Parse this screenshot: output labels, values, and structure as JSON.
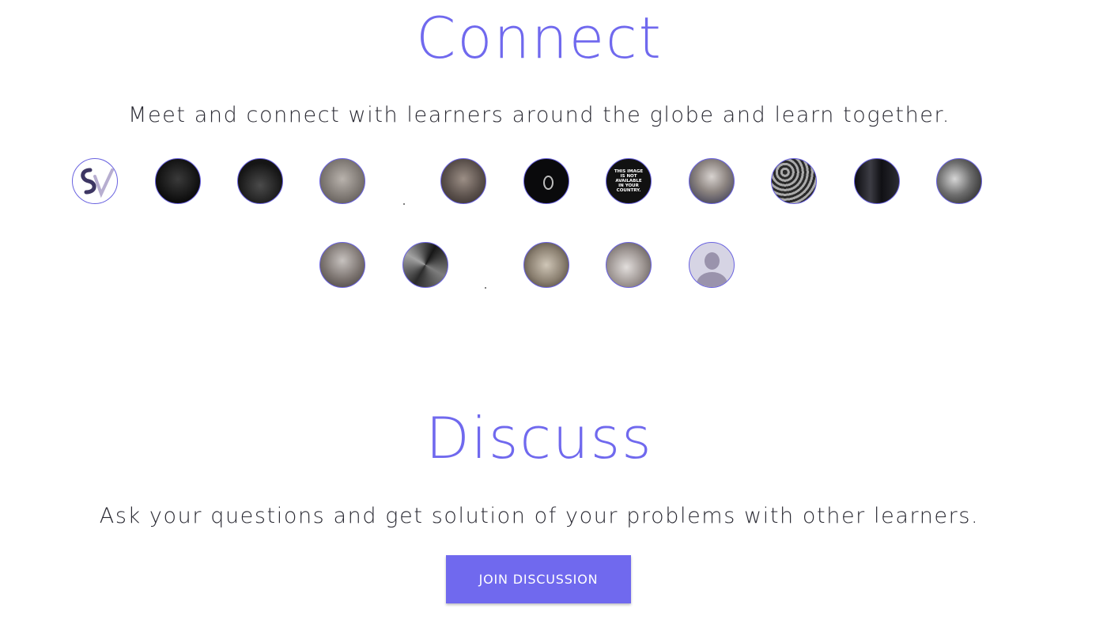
{
  "connect": {
    "title": "Connect",
    "subtitle": "Meet and connect with learners around the globe and learn together."
  },
  "avatars": {
    "row1": [
      "sv-logo",
      "dark-art",
      "night-scene",
      "face-photo",
      "man-photo",
      "black-mark",
      "not-available",
      "man-blue-shirt",
      "pattern",
      "stage-photo",
      "couple-photo"
    ],
    "row2": [
      "old-man",
      "abstract-art",
      "lion-photo",
      "animal-photo",
      "default-avatar"
    ],
    "not_available_text": "THIS IMAGE IS NOT AVAILABLE IN YOUR COUNTRY."
  },
  "discuss": {
    "title": "Discuss",
    "subtitle": "Ask your questions and get solution of your problems with other learners.",
    "button_label": "JOIN DISCUSSION"
  },
  "colors": {
    "accent": "#7069ee",
    "text": "#2a2a33",
    "background": "#ffffff"
  }
}
